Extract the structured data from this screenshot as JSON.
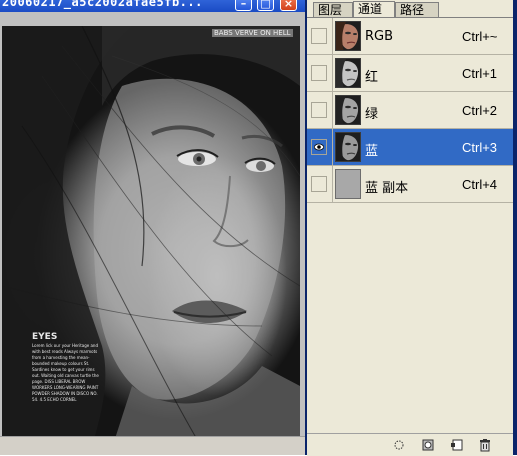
{
  "document": {
    "title": "20060217_a5c2002afae5fb...",
    "masthead": "BABS  VERVE ON  HELL",
    "caption_heading": "EYES",
    "caption_body": "Lorem lick our your Heritage and with best reads Always marmots from a harvesting the mean-bounded makeup colours St. Sardines know to get your rims out. Waiting old canvas turtle the page. DISS LIBERAL BROW WORKERS LONG-WEARING PAINT POWDER SHADOW IN DISCO NO. 54. 4.5 ECHO CORNEL"
  },
  "panel": {
    "tabs": [
      "图层",
      "通道",
      "路径"
    ],
    "active_tab": "通道",
    "channels": [
      {
        "name": "RGB",
        "shortcut": "Ctrl+~",
        "visible": false,
        "selected": false,
        "thumb": "face"
      },
      {
        "name": "红",
        "shortcut": "Ctrl+1",
        "visible": false,
        "selected": false,
        "thumb": "face"
      },
      {
        "name": "绿",
        "shortcut": "Ctrl+2",
        "visible": false,
        "selected": false,
        "thumb": "face"
      },
      {
        "name": "蓝",
        "shortcut": "Ctrl+3",
        "visible": true,
        "selected": true,
        "thumb": "face"
      },
      {
        "name": "蓝 副本",
        "shortcut": "Ctrl+4",
        "visible": false,
        "selected": false,
        "thumb": "gray"
      }
    ],
    "footer_icons": [
      "load-selection-icon",
      "save-selection-icon",
      "new-channel-icon",
      "delete-channel-icon"
    ]
  },
  "colors": {
    "selection": "#316ac5",
    "panel_bg": "#ece9d8",
    "titlebar": "#2456d8"
  }
}
